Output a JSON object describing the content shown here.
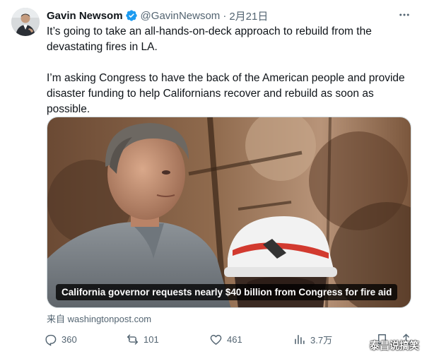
{
  "author": {
    "name": "Gavin Newsom",
    "handle": "@GavinNewsom",
    "separator": "·",
    "date": "2月21日"
  },
  "tweet": {
    "paragraphs": [
      "It’s going to take an all-hands-on-deck approach to rebuild from the devastating fires in LA.",
      "I’m asking Congress to have the back of the American people and provide disaster funding to help Californians recover and rebuild as soon as possible."
    ]
  },
  "media": {
    "caption": "California governor requests nearly $40 billion from Congress for fire aid"
  },
  "source": {
    "text": "来自 washingtonpost.com"
  },
  "actions": {
    "replies": "360",
    "reposts": "101",
    "likes": "461",
    "views": "3.7万"
  },
  "watermark": "泰昌说搞笑",
  "colors": {
    "text": "#0f1419",
    "secondary": "#536471",
    "verified": "#1d9bf0"
  },
  "icons": [
    "more-icon",
    "verified-badge-icon",
    "reply-icon",
    "repost-icon",
    "like-icon",
    "views-icon",
    "bookmark-icon",
    "share-icon"
  ]
}
